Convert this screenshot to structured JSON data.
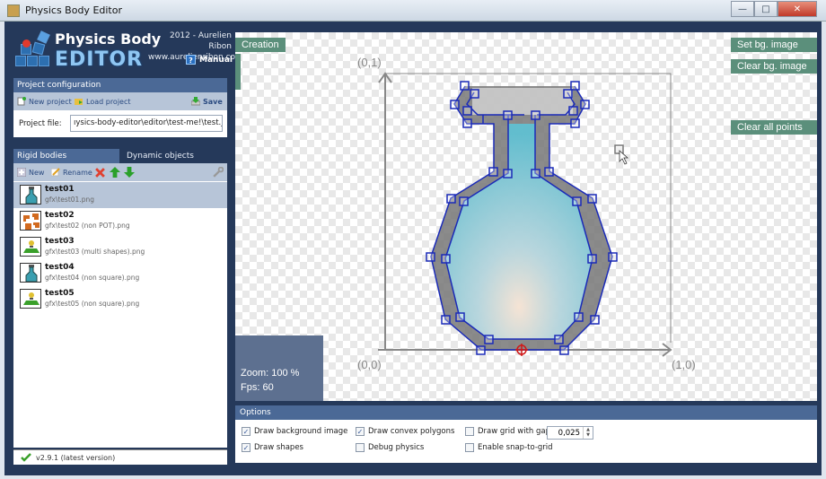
{
  "window": {
    "title": "Physics Body Editor",
    "controls": {
      "minimize": "—",
      "maximize": "□",
      "close": "✕"
    }
  },
  "header": {
    "logo_line1": "Physics Body",
    "logo_line2": "EDITOR",
    "credit_line1": "2012 - Aurelien Ribon",
    "credit_line2": "www.aurelienribon.com",
    "manual_icon": "?",
    "manual_label": "Manual"
  },
  "project_config": {
    "title": "Project configuration",
    "new_label": "New project",
    "load_label": "Load project",
    "save_label": "Save",
    "file_label": "Project file:",
    "file_value": "ıysics-body-editor\\editor\\test-me!\\test.json"
  },
  "tabs": [
    {
      "label": "Rigid bodies",
      "active": true
    },
    {
      "label": "Dynamic objects",
      "active": false
    }
  ],
  "body_tools": {
    "new_label": "New",
    "rename_label": "Rename"
  },
  "bodies": [
    {
      "name": "test01",
      "path": "gfx\\test01.png",
      "selected": true,
      "thumb": "flask"
    },
    {
      "name": "test02",
      "path": "gfx\\test02 (non POT).png",
      "selected": false,
      "thumb": "puzzle"
    },
    {
      "name": "test03",
      "path": "gfx\\test03 (multi shapes).png",
      "selected": false,
      "thumb": "platform"
    },
    {
      "name": "test04",
      "path": "gfx\\test04 (non square).png",
      "selected": false,
      "thumb": "flask"
    },
    {
      "name": "test05",
      "path": "gfx\\test05 (non square).png",
      "selected": false,
      "thumb": "platform"
    }
  ],
  "version": "v2.9.1 (latest version)",
  "canvas": {
    "creation_label": "Creation",
    "set_bg_label": "Set bg. image",
    "clear_bg_label": "Clear bg. image",
    "clear_points_label": "Clear all points",
    "zoom_text": "Zoom: 100 %",
    "fps_text": "Fps: 60",
    "axis_00": "(0,0)",
    "axis_01": "(0,1)",
    "axis_10": "(1,0)"
  },
  "options": {
    "title": "Options",
    "draw_bg": {
      "label": "Draw background image",
      "checked": true
    },
    "draw_shapes": {
      "label": "Draw shapes",
      "checked": true
    },
    "draw_convex": {
      "label": "Draw convex polygons",
      "checked": true
    },
    "debug_physics": {
      "label": "Debug physics",
      "checked": false
    },
    "draw_grid": {
      "label": "Draw grid with gap",
      "checked": false
    },
    "snap_grid": {
      "label": "Enable snap-to-grid",
      "checked": false
    },
    "grid_gap_value": "0,025"
  }
}
